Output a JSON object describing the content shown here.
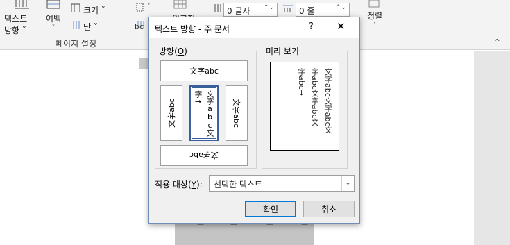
{
  "ribbon": {
    "text_direction_label_1": "텍스트",
    "text_direction_label_2": "방향 ˅",
    "margins_label": "여백",
    "margins_arrow": "˅",
    "size_label": "크기 ˅",
    "columns_label": "단 ˅",
    "orientation_arrow": "˅",
    "hyphen_icon": "bc",
    "watermark_label": "원고지",
    "indent_value": "0 글자",
    "spacing_value": "0 줄",
    "arrange_label": "정렬",
    "arrange_arrow": "˅",
    "group_label": "페이지 설정",
    "collapse": "^"
  },
  "dialog": {
    "title": "텍스트 방향 - 주 문서",
    "help": "?",
    "close": "✕",
    "orientation_legend_prefix": "방향(",
    "orientation_legend_key": "O",
    "orientation_legend_suffix": ")",
    "preview_legend": "미리 보기",
    "options": {
      "horizontal": "文字abc",
      "rotate_left": "文字abc",
      "vertical_col1": "文字abc文",
      "vertical_col2": "字→",
      "rotate_right": "文字abc",
      "horizontal_flipped": "文字abc"
    },
    "preview_columns": [
      "文字abc文字abc文",
      "字abc文字abc文",
      "字abc→"
    ],
    "apply_prefix": "적용 대상(",
    "apply_key": "Y",
    "apply_suffix": "):",
    "apply_value": "선택한 텍스트",
    "ok": "확인",
    "cancel": "취소"
  },
  "document": {
    "strip_chars": [
      "ㅗ",
      "ㅗ",
      "ㅗ",
      "ㅗ"
    ]
  }
}
